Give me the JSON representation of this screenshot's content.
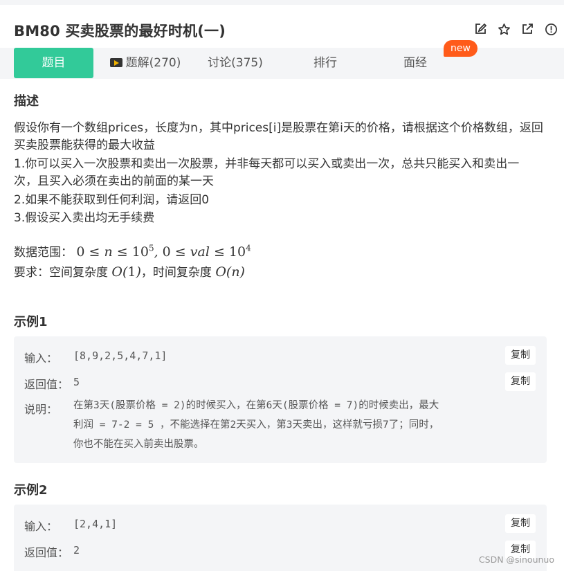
{
  "title": "BM80  买卖股票的最好时机(一)",
  "actions": [
    {
      "icon": "edit-icon"
    },
    {
      "icon": "star-icon"
    },
    {
      "icon": "external-link-icon"
    },
    {
      "icon": "report-icon"
    }
  ],
  "tabs": {
    "problem": "题目",
    "solutions": "题解(270)",
    "discuss": "讨论(375)",
    "rank": "排行",
    "interview": "面经",
    "new_badge": "new"
  },
  "description": {
    "heading": "描述",
    "line1": "假设你有一个数组prices，长度为n，其中prices[i]是股票在第i天的价格，请根据这个价格数组，返回",
    "line2": "买卖股票能获得的最大收益",
    "line3": "1.你可以买入一次股票和卖出一次股票，并非每天都可以买入或卖出一次，总共只能买入和卖出一",
    "line4": "次，且买入必须在卖出的前面的某一天",
    "line5": "2.如果不能获取到任何利润，请返回0",
    "line6": "3.假设买入卖出均无手续费",
    "range_label": "数据范围：",
    "req_label": "要求：空间复杂度",
    "req_mid": "，时间复杂度"
  },
  "example1": {
    "heading": "示例1",
    "input_label": "输入：",
    "input_value": "[8,9,2,5,4,7,1]",
    "output_label": "返回值：",
    "output_value": "5",
    "explain_label": "说明：",
    "explain_line1": "在第3天(股票价格 = 2)的时候买入，在第6天(股票价格 = 7)的时候卖出，最大",
    "explain_line2": "利润 = 7-2 = 5 ，不能选择在第2天买入，第3天卖出，这样就亏损7了；同时，",
    "explain_line3": "你也不能在买入前卖出股票。",
    "copy": "复制"
  },
  "example2": {
    "heading": "示例2",
    "input_label": "输入：",
    "input_value": "[2,4,1]",
    "output_label": "返回值：",
    "output_value": "2",
    "copy": "复制"
  },
  "watermark": "CSDN @sinounuo"
}
